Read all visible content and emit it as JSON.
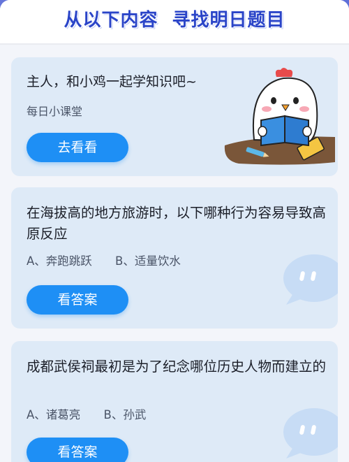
{
  "header": {
    "title_left": "从以下内容",
    "title_right": "寻找明日题目"
  },
  "intro_card": {
    "title": "主人，和小鸡一起学知识吧~",
    "subtitle": "每日小课堂",
    "button_label": "去看看"
  },
  "questions": [
    {
      "question": "在海拔高的地方旅游时，以下哪种行为容易导致高原反应",
      "option_a": "A、奔跑跳跃",
      "option_b": "B、适量饮水",
      "button_label": "看答案"
    },
    {
      "question": "成都武侯祠最初是为了纪念哪位历史人物而建立的",
      "option_a": "A、诸葛亮",
      "option_b": "B、孙武",
      "button_label": "看答案"
    }
  ],
  "colors": {
    "background": "#5e6fd8",
    "panel": "#f3f5fa",
    "card": "#deeaf7",
    "button": "#1e8ff5",
    "title": "#2a44c8"
  }
}
